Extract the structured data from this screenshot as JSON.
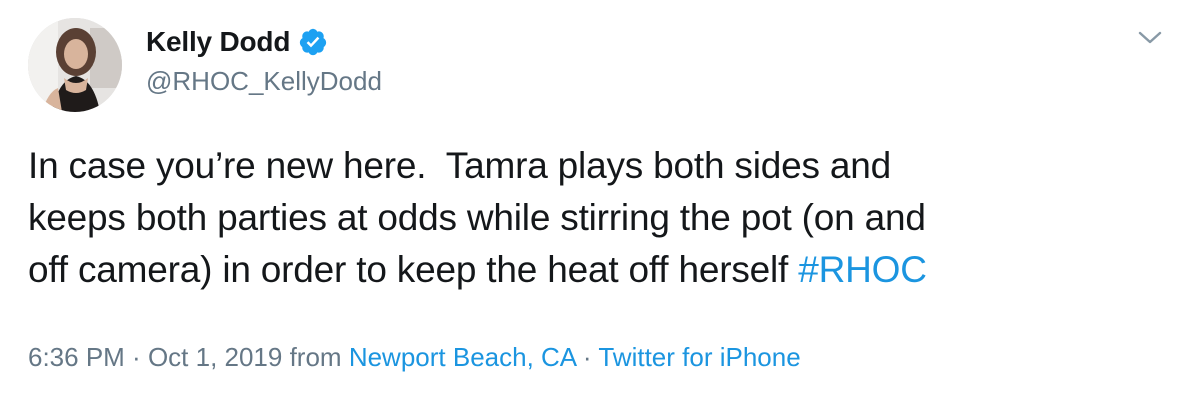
{
  "author": {
    "display_name": "Kelly Dodd",
    "handle": "@RHOC_KellyDodd",
    "verified": true
  },
  "tweet": {
    "lines": [
      "In case you’re new here.  Tamra plays both sides and",
      "keeps both parties at odds while stirring the pot (on and",
      "off camera) in order to keep the heat off herself "
    ],
    "hashtag": "#RHOC"
  },
  "meta": {
    "time": "6:36 PM",
    "separator1": " · ",
    "date": "Oct 1, 2019",
    "from_label": " from ",
    "location": "Newport Beach, CA",
    "separator2": " · ",
    "source": "Twitter for iPhone"
  },
  "icons": {
    "verified": "verified-badge-icon",
    "caret": "chevron-down-icon"
  },
  "colors": {
    "link": "#1b95e0",
    "secondary_text": "#657786",
    "primary_text": "#14171a",
    "verified_badge": "#1da1f2"
  }
}
